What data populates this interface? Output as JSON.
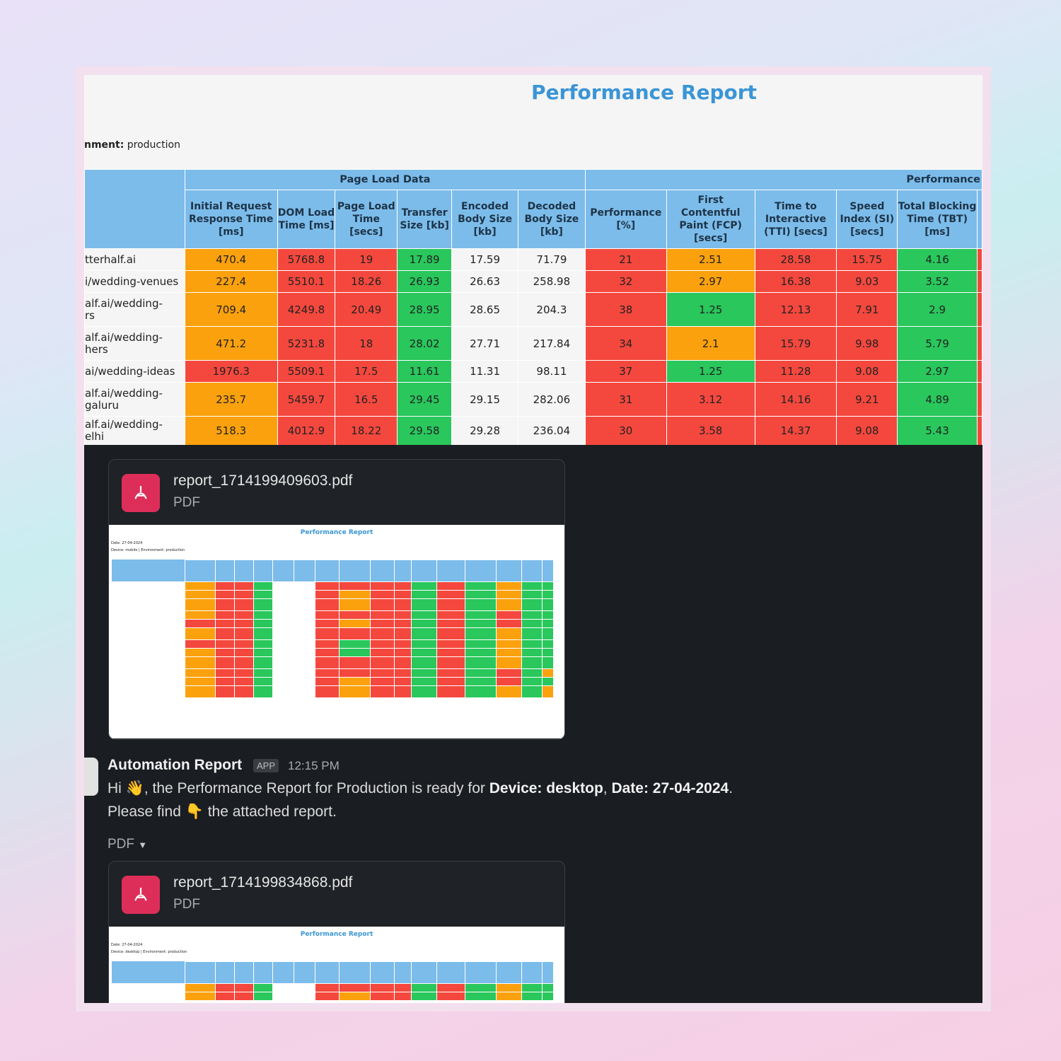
{
  "report": {
    "title": "Performance Report",
    "env_label": "nment:",
    "env_value": "production",
    "group_page_load": "Page Load Data",
    "group_performance": "Performance",
    "headers": [
      "Initial Request Response Time [ms]",
      "DOM Load Time [ms]",
      "Page Load Time [secs]",
      "Transfer Size [kb]",
      "Encoded Body Size [kb]",
      "Decoded Body Size [kb]",
      "Performance [%]",
      "First Contentful Paint (FCP) [secs]",
      "Time to Interactive (TTI) [secs]",
      "Speed Index (SI) [secs]",
      "Total Blocking Time (TBT) [ms]"
    ],
    "rows": [
      {
        "url": "tterhalf.ai",
        "cells": [
          "470.4",
          "5768.8",
          "19",
          "17.89",
          "17.59",
          "71.79",
          "21",
          "2.51",
          "28.58",
          "15.75",
          "4.16"
        ],
        "colors": [
          "o",
          "r",
          "r",
          "g",
          "w",
          "w",
          "r",
          "o",
          "r",
          "r",
          "g"
        ]
      },
      {
        "url": "i/wedding-venues",
        "cells": [
          "227.4",
          "5510.1",
          "18.26",
          "26.93",
          "26.63",
          "258.98",
          "32",
          "2.97",
          "16.38",
          "9.03",
          "3.52"
        ],
        "colors": [
          "o",
          "r",
          "r",
          "g",
          "w",
          "w",
          "r",
          "o",
          "r",
          "r",
          "g"
        ]
      },
      {
        "url": "alf.ai/wedding-\nrs",
        "cells": [
          "709.4",
          "4249.8",
          "20.49",
          "28.95",
          "28.65",
          "204.3",
          "38",
          "1.25",
          "12.13",
          "7.91",
          "2.9"
        ],
        "colors": [
          "o",
          "r",
          "r",
          "g",
          "w",
          "w",
          "r",
          "g",
          "r",
          "r",
          "g"
        ]
      },
      {
        "url": "alf.ai/wedding-\nhers",
        "cells": [
          "471.2",
          "5231.8",
          "18",
          "28.02",
          "27.71",
          "217.84",
          "34",
          "2.1",
          "15.79",
          "9.98",
          "5.79"
        ],
        "colors": [
          "o",
          "r",
          "r",
          "g",
          "w",
          "w",
          "r",
          "o",
          "r",
          "r",
          "g"
        ]
      },
      {
        "url": "ai/wedding-ideas",
        "cells": [
          "1976.3",
          "5509.1",
          "17.5",
          "11.61",
          "11.31",
          "98.11",
          "37",
          "1.25",
          "11.28",
          "9.08",
          "2.97"
        ],
        "colors": [
          "r",
          "r",
          "r",
          "g",
          "w",
          "w",
          "r",
          "g",
          "r",
          "r",
          "g"
        ]
      },
      {
        "url": "alf.ai/wedding-\ngaluru",
        "cells": [
          "235.7",
          "5459.7",
          "16.5",
          "29.45",
          "29.15",
          "282.06",
          "31",
          "3.12",
          "14.16",
          "9.21",
          "4.89"
        ],
        "colors": [
          "o",
          "r",
          "r",
          "g",
          "w",
          "w",
          "r",
          "r",
          "r",
          "r",
          "g"
        ]
      },
      {
        "url": "alf.ai/wedding-\nelhi",
        "cells": [
          "518.3",
          "4012.9",
          "18.22",
          "29.58",
          "29.28",
          "236.04",
          "30",
          "3.58",
          "14.37",
          "9.08",
          "5.43"
        ],
        "colors": [
          "o",
          "r",
          "r",
          "g",
          "w",
          "w",
          "r",
          "r",
          "r",
          "r",
          "g"
        ]
      }
    ]
  },
  "attachments": [
    {
      "name": "report_1714199409603.pdf",
      "type": "PDF",
      "thumb_title": "Performance Report",
      "thumb_date": "Date: 27-04-2024",
      "thumb_device": "Device: mobile | Environment: production"
    },
    {
      "name": "report_1714199834868.pdf",
      "type": "PDF",
      "thumb_title": "Performance Report",
      "thumb_date": "Date: 27-04-2024",
      "thumb_device": "Device: desktop | Environment: production"
    }
  ],
  "message": {
    "sender": "Automation Report",
    "badge": "APP",
    "time": "12:15 PM",
    "line1_a": "Hi 👋, the Performance Report for Production is ready for ",
    "line1_b": "Device: desktop",
    "line1_c": ", ",
    "line1_d": "Date: 27-04-2024",
    "line1_e": ".",
    "line2": "Please find 👇 the attached report.",
    "attachment_toggle": "PDF"
  },
  "colors": {
    "red": "#f4483e",
    "orange": "#fba10e",
    "green": "#29c75c",
    "header_blue": "#7cbcea",
    "title_blue": "#3a95d6",
    "pdf_icon": "#dd2e5a"
  }
}
